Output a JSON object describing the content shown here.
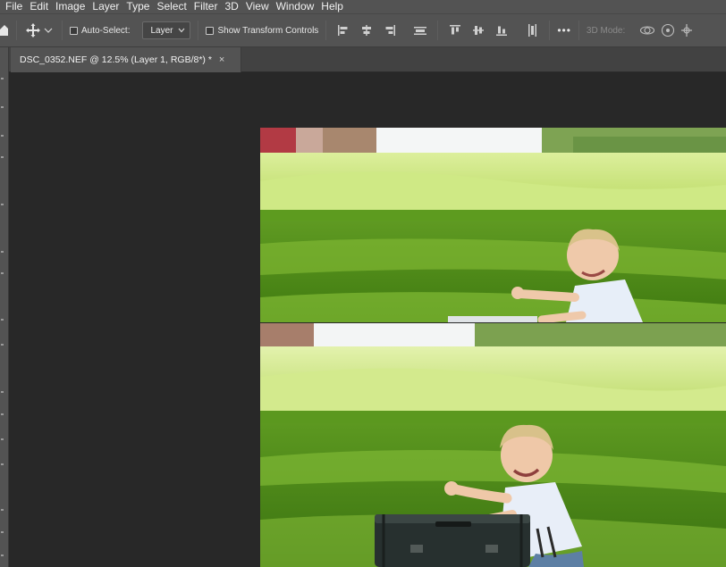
{
  "menu": {
    "items": [
      "File",
      "Edit",
      "Image",
      "Layer",
      "Type",
      "Select",
      "Filter",
      "3D",
      "View",
      "Window",
      "Help"
    ]
  },
  "options": {
    "tool_icon": "move-icon",
    "auto_select_label": "Auto-Select:",
    "auto_select_checked": false,
    "target_value": "Layer",
    "show_transform_label": "Show Transform Controls",
    "show_transform_checked": false,
    "more_label": "•••",
    "mode_3d_label": "3D Mode:"
  },
  "document": {
    "tab_title": "DSC_0352.NEF @ 12.5% (Layer 1, RGB/8*) *",
    "close_label": "×"
  },
  "colors": {
    "ui_panel": "#535353",
    "canvas_bg": "#282828",
    "tab_bar": "#424242"
  }
}
